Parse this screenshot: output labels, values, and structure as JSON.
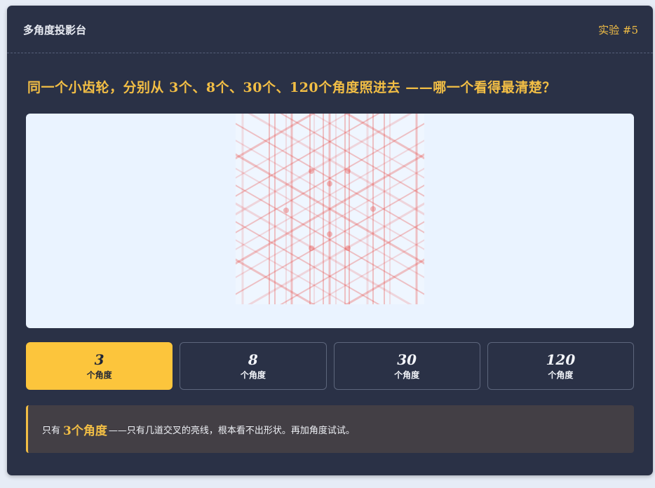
{
  "header": {
    "title": "多角度投影台",
    "badge": "实验 #5"
  },
  "question": "同一个小齿轮，分别从 3个、8个、30个、120个角度照进去 ——哪一个看得最清楚？",
  "angle_buttons": [
    {
      "value": "3",
      "unit": "个角度",
      "active": true
    },
    {
      "value": "8",
      "unit": "个角度",
      "active": false
    },
    {
      "value": "30",
      "unit": "个角度",
      "active": false
    },
    {
      "value": "120",
      "unit": "个角度",
      "active": false
    }
  ],
  "note": {
    "prefix": "只有",
    "highlight": "3个角度",
    "suffix": "——只有几道交叉的亮线，根本看不出形状。再加角度试试。"
  },
  "colors": {
    "panel": "#2a3146",
    "accent": "#f2be45",
    "active_button": "#fcc53c",
    "canvas_bg": "#eaf3ff",
    "streak": "#e8423c",
    "note_bg": "#433f45"
  },
  "projection": {
    "angles_count": 3
  }
}
